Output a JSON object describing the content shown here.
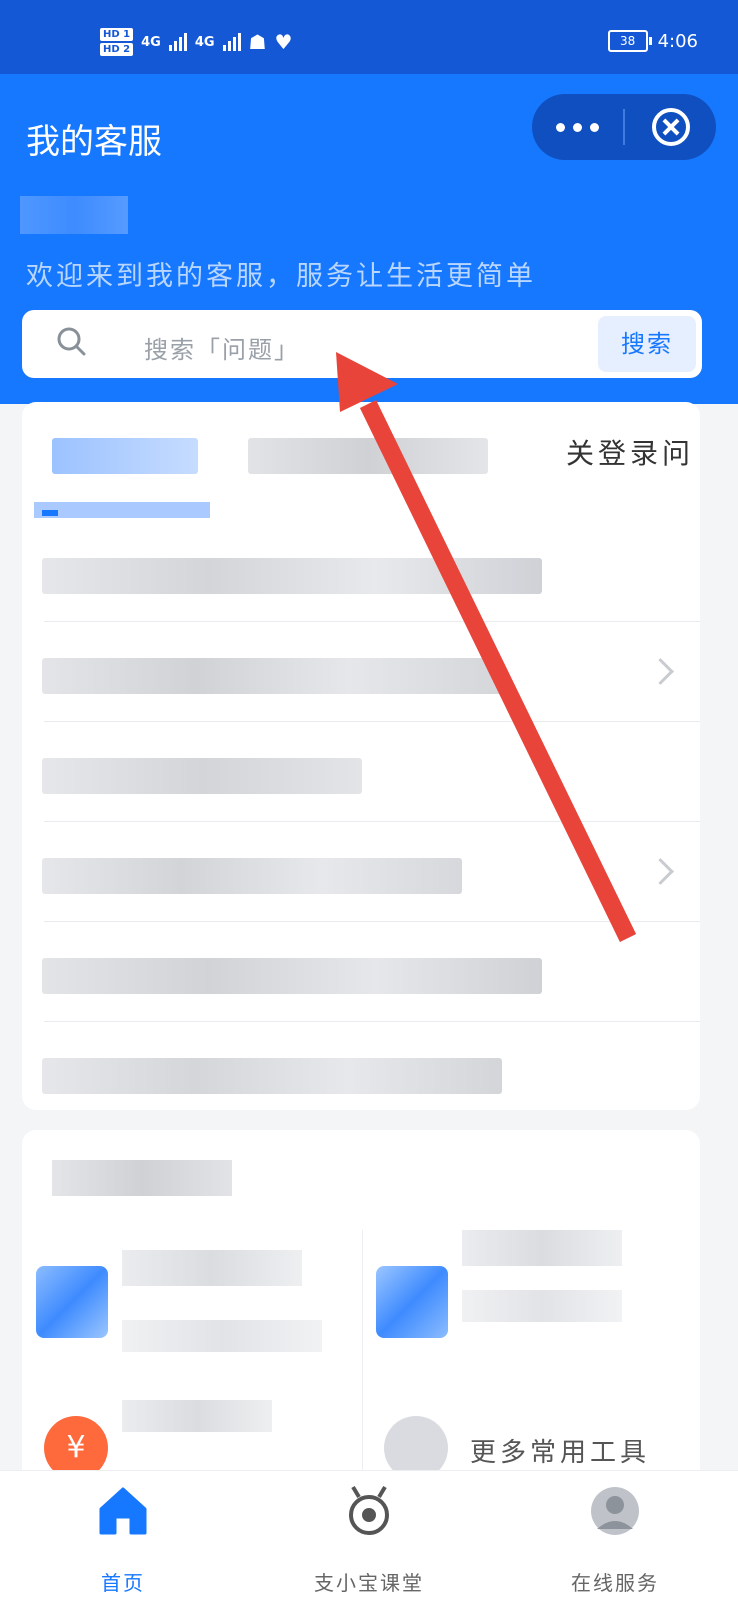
{
  "status_bar": {
    "hd1": "HD 1",
    "hd2": "HD 2",
    "net1": "4G",
    "net2": "4G",
    "battery": "38",
    "time": "4:06"
  },
  "header": {
    "title": "我的客服",
    "welcome": "欢迎来到我的客服，服务让生活更简单"
  },
  "search": {
    "placeholder": "搜索「问题」",
    "button": "搜索"
  },
  "card1": {
    "top_label": "关登录问"
  },
  "card2": {
    "tiles": [
      {
        "icon": "blue-grid-icon"
      },
      {
        "icon": "blue-grid-icon"
      },
      {
        "icon": "yuan-invoice-icon"
      },
      {
        "icon": "more-tools-icon",
        "label": "更多常用工具"
      }
    ]
  },
  "tabbar": {
    "items": [
      {
        "label": "首页",
        "icon": "home-icon",
        "active": true
      },
      {
        "label": "支小宝课堂",
        "icon": "robot-icon",
        "active": false
      },
      {
        "label": "在线服务",
        "icon": "service-avatar-icon",
        "active": false
      }
    ]
  },
  "colors": {
    "brand": "#1677ff",
    "status_bar": "#1558d6",
    "annotation_arrow": "#e8443a"
  }
}
